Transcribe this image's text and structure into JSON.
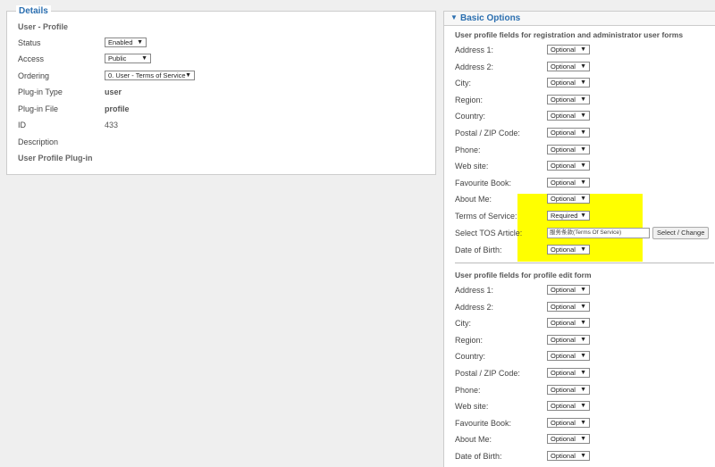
{
  "details": {
    "legend": "Details",
    "title": "User - Profile",
    "fields": [
      {
        "label": "Status",
        "value": "Enabled"
      },
      {
        "label": "Access",
        "value": "Public"
      },
      {
        "label": "Ordering",
        "value": "0. User - Terms of Service"
      },
      {
        "label": "Plug-in Type",
        "value": "user"
      },
      {
        "label": "Plug-in File",
        "value": "profile"
      },
      {
        "label": "ID",
        "value": "433"
      },
      {
        "label": "Description",
        "value": ""
      }
    ],
    "description": "User Profile Plug-in"
  },
  "basic": {
    "title": "Basic Options",
    "registration_title": "User profile fields for registration and administrator user forms",
    "registration_fields": [
      {
        "label": "Address 1:",
        "value": "Optional"
      },
      {
        "label": "Address 2:",
        "value": "Optional"
      },
      {
        "label": "City:",
        "value": "Optional"
      },
      {
        "label": "Region:",
        "value": "Optional"
      },
      {
        "label": "Country:",
        "value": "Optional"
      },
      {
        "label": "Postal / ZIP Code:",
        "value": "Optional"
      },
      {
        "label": "Phone:",
        "value": "Optional"
      },
      {
        "label": "Web site:",
        "value": "Optional"
      },
      {
        "label": "Favourite Book:",
        "value": "Optional"
      },
      {
        "label": "About Me:",
        "value": "Optional"
      },
      {
        "label": "Terms of Service:",
        "value": "Required"
      }
    ],
    "tos": {
      "label": "Select TOS Article:",
      "value": "服务条款(Terms Of Service)",
      "button": "Select / Change"
    },
    "dob": {
      "label": "Date of Birth:",
      "value": "Optional"
    },
    "profile_title": "User profile fields for profile edit form",
    "profile_fields": [
      {
        "label": "Address 1:",
        "value": "Optional"
      },
      {
        "label": "Address 2:",
        "value": "Optional"
      },
      {
        "label": "City:",
        "value": "Optional"
      },
      {
        "label": "Region:",
        "value": "Optional"
      },
      {
        "label": "Country:",
        "value": "Optional"
      },
      {
        "label": "Postal / ZIP Code:",
        "value": "Optional"
      },
      {
        "label": "Phone:",
        "value": "Optional"
      },
      {
        "label": "Web site:",
        "value": "Optional"
      },
      {
        "label": "Favourite Book:",
        "value": "Optional"
      },
      {
        "label": "About Me:",
        "value": "Optional"
      },
      {
        "label": "Date of Birth:",
        "value": "Optional"
      }
    ]
  },
  "colors": {
    "accent": "#2b6fb0",
    "highlight": "#ffff00"
  }
}
